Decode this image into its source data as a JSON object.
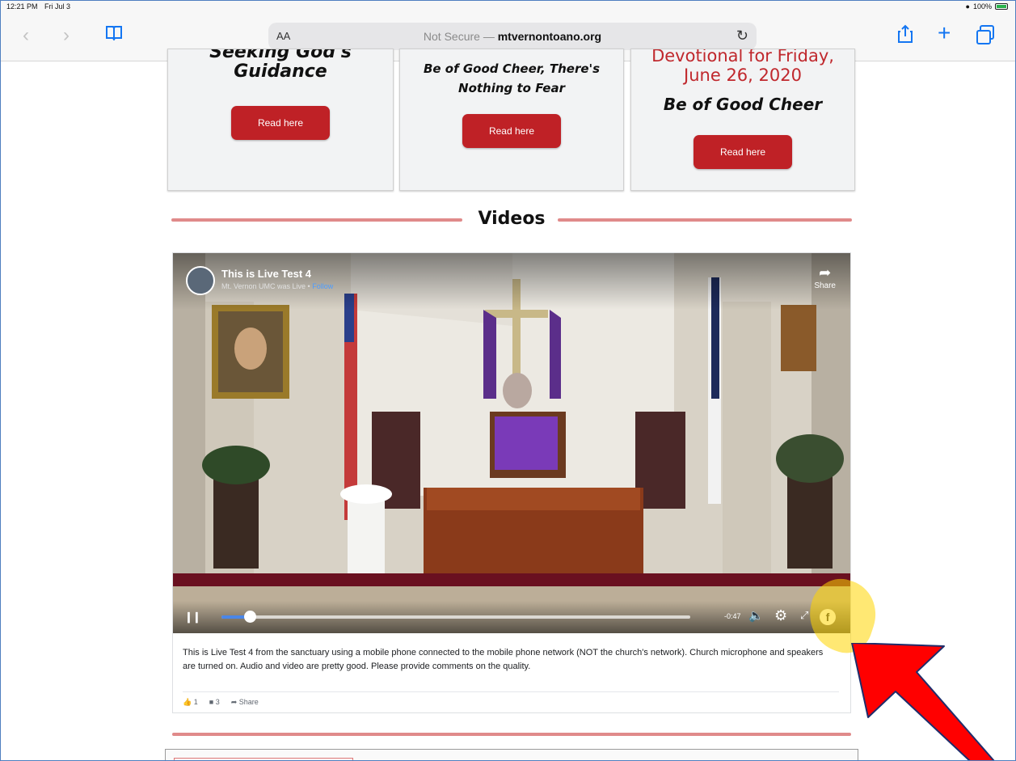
{
  "status_bar": {
    "time": "12:21 PM",
    "date": "Fri Jul 3",
    "battery": "100%"
  },
  "browser": {
    "text_size_label": "AA",
    "url_security": "Not Secure —",
    "url_domain": "mtvernontoano.org"
  },
  "cards": [
    {
      "title": "Seeking God's Guidance",
      "button": "Read here"
    },
    {
      "title_line1": "Be of Good Cheer, There's",
      "title_line2": "Nothing to Fear",
      "button": "Read here"
    },
    {
      "date_line1": "Devotional for Friday,",
      "date_line2": "June 26, 2020",
      "title": "Be of Good Cheer",
      "button": "Read here"
    }
  ],
  "section_heading": "Videos",
  "video": {
    "title": "This is Live Test 4",
    "subtitle": "Mt. Vernon UMC was Live",
    "follow": "Follow",
    "share_label": "Share",
    "time_remaining": "-0:47",
    "progress": 0.06,
    "description": "This is Live Test 4 from the sanctuary using a mobile phone connected to the mobile phone network (NOT the church's network). Church microphone and speakers are turned on. Audio and video are pretty good. Please provide comments on the quality.",
    "likes": "1",
    "comments": "3",
    "share_action": "Share"
  },
  "colors": {
    "accent_red": "#bf2126",
    "divider_pink": "#e08a8a",
    "safari_blue": "#1476f2",
    "highlight_yellow": "#ffd600",
    "arrow_red": "#ff0000"
  },
  "icons": [
    "back-icon",
    "forward-icon",
    "bookmarks-icon",
    "reload-icon",
    "share-icon",
    "new-tab-icon",
    "tabs-icon",
    "pause-icon",
    "volume-icon",
    "settings-icon",
    "fullscreen-icon",
    "facebook-icon",
    "like-icon",
    "comment-icon"
  ]
}
